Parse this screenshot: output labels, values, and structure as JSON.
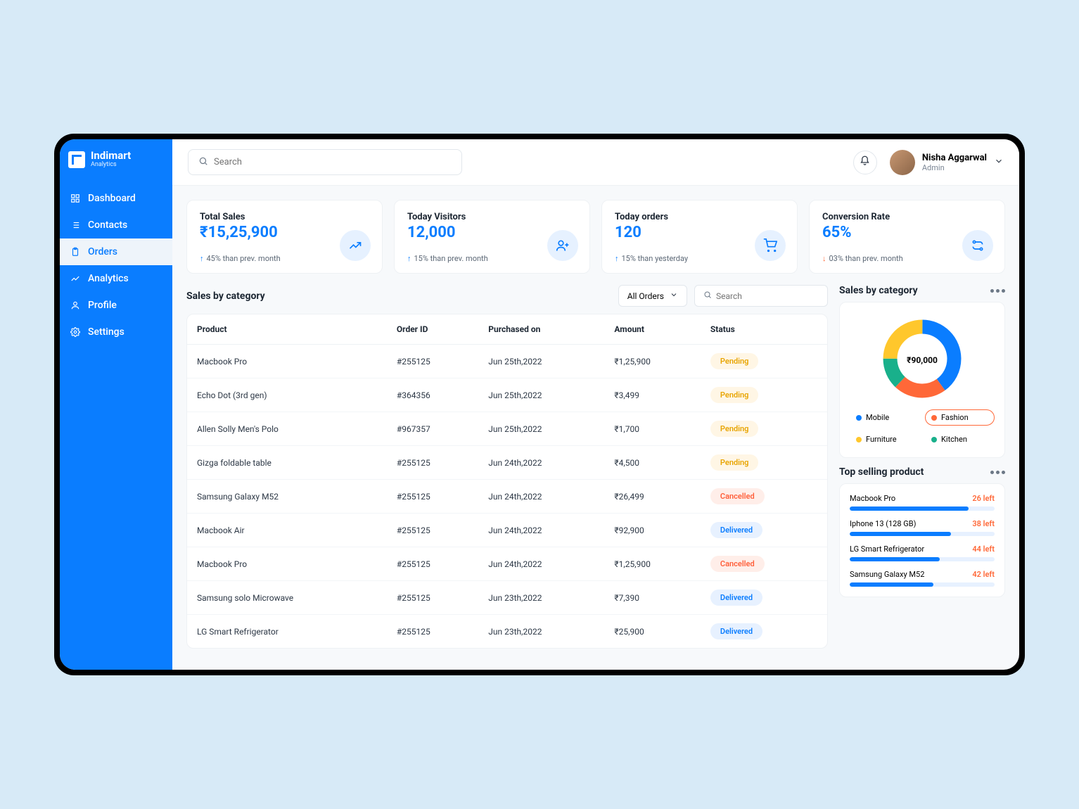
{
  "brand": {
    "name": "Indimart",
    "sub": "Analytics"
  },
  "sidebar": {
    "items": [
      {
        "label": "Dashboard",
        "icon": "grid"
      },
      {
        "label": "Contacts",
        "icon": "list"
      },
      {
        "label": "Orders",
        "icon": "clipboard",
        "active": true
      },
      {
        "label": "Analytics",
        "icon": "chart"
      },
      {
        "label": "Profile",
        "icon": "user"
      },
      {
        "label": "Settings",
        "icon": "gear"
      }
    ]
  },
  "header": {
    "search_placeholder": "Search",
    "user_name": "Nisha Aggarwal",
    "user_role": "Admin"
  },
  "cards": [
    {
      "title": "Total Sales",
      "value": "₹15,25,900",
      "delta_dir": "up",
      "delta": "45% than prev. month",
      "icon": "trend"
    },
    {
      "title": "Today Visitors",
      "value": "12,000",
      "delta_dir": "up",
      "delta": "15% than prev. month",
      "icon": "person-add"
    },
    {
      "title": "Today orders",
      "value": "120",
      "delta_dir": "up",
      "delta": "15% than yesterday",
      "icon": "cart"
    },
    {
      "title": "Conversion Rate",
      "value": "65%",
      "delta_dir": "down",
      "delta": "03% than prev. month",
      "icon": "flow"
    }
  ],
  "table": {
    "title": "Sales by category",
    "filter_label": "All Orders",
    "search_placeholder": "Search",
    "columns": [
      "Product",
      "Order ID",
      "Purchased on",
      "Amount",
      "Status"
    ],
    "rows": [
      {
        "product": "Macbook Pro",
        "order_id": "#255125",
        "date": "Jun 25th,2022",
        "amount": "₹1,25,900",
        "status": "Pending"
      },
      {
        "product": "Echo Dot (3rd gen)",
        "order_id": "#364356",
        "date": "Jun 25th,2022",
        "amount": "₹3,499",
        "status": "Pending"
      },
      {
        "product": "Allen Solly Men's Polo",
        "order_id": "#967357",
        "date": "Jun 25th,2022",
        "amount": "₹1,700",
        "status": "Pending"
      },
      {
        "product": "Gizga foldable table",
        "order_id": "#255125",
        "date": "Jun 24th,2022",
        "amount": "₹4,500",
        "status": "Pending"
      },
      {
        "product": "Samsung Galaxy M52",
        "order_id": "#255125",
        "date": "Jun 24th,2022",
        "amount": "₹26,499",
        "status": "Cancelled"
      },
      {
        "product": "Macbook Air",
        "order_id": "#255125",
        "date": "Jun 24th,2022",
        "amount": "₹92,900",
        "status": "Delivered"
      },
      {
        "product": "Macbook Pro",
        "order_id": "#255125",
        "date": "Jun 24th,2022",
        "amount": "₹1,25,900",
        "status": "Cancelled"
      },
      {
        "product": "Samsung solo Microwave",
        "order_id": "#255125",
        "date": "Jun 23th,2022",
        "amount": "₹7,390",
        "status": "Delivered"
      },
      {
        "product": "LG Smart Refrigerator",
        "order_id": "#255125",
        "date": "Jun 23th,2022",
        "amount": "₹25,900",
        "status": "Delivered"
      }
    ]
  },
  "category_chart": {
    "title": "Sales by category",
    "center_value": "₹90,000",
    "legend": [
      {
        "label": "Mobile",
        "color": "#0a7dff"
      },
      {
        "label": "Fashion",
        "color": "#ff6838",
        "active": true
      },
      {
        "label": "Furniture",
        "color": "#ffc72c"
      },
      {
        "label": "Kitchen",
        "color": "#19b08b"
      }
    ]
  },
  "top_selling": {
    "title": "Top selling product",
    "items": [
      {
        "name": "Macbook Pro",
        "left": "26 left",
        "pct": 82
      },
      {
        "name": "Iphone 13 (128 GB)",
        "left": "38 left",
        "pct": 70
      },
      {
        "name": "LG Smart Refrigerator",
        "left": "44 left",
        "pct": 62
      },
      {
        "name": "Samsung Galaxy M52",
        "left": "42 left",
        "pct": 58
      }
    ]
  },
  "chart_data": {
    "type": "pie",
    "title": "Sales by category",
    "center_label": "₹90,000",
    "series": [
      {
        "name": "Mobile",
        "value": 40,
        "color": "#0a7dff"
      },
      {
        "name": "Fashion",
        "value": 22,
        "color": "#ff6838"
      },
      {
        "name": "Kitchen",
        "value": 13,
        "color": "#19b08b"
      },
      {
        "name": "Furniture",
        "value": 25,
        "color": "#ffc72c"
      }
    ]
  }
}
